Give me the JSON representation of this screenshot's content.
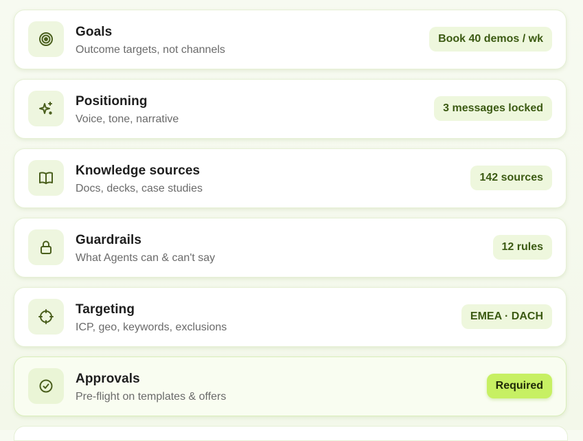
{
  "items": [
    {
      "title": "Goals",
      "subtitle": "Outcome targets, not channels",
      "badge": "Book 40 demos / wk",
      "icon": "target-icon"
    },
    {
      "title": "Positioning",
      "subtitle": "Voice, tone, narrative",
      "badge": "3 messages locked",
      "icon": "sparkles-icon"
    },
    {
      "title": "Knowledge sources",
      "subtitle": "Docs, decks, case studies",
      "badge": "142 sources",
      "icon": "book-open-icon"
    },
    {
      "title": "Guardrails",
      "subtitle": "What Agents can & can't say",
      "badge": "12 rules",
      "icon": "lock-icon"
    },
    {
      "title": "Targeting",
      "subtitle": "ICP, geo, keywords, exclusions",
      "badge": "EMEA · DACH",
      "icon": "crosshair-icon"
    },
    {
      "title": "Approvals",
      "subtitle": "Pre-flight on templates & offers",
      "badge": "Required",
      "icon": "check-circle-icon"
    }
  ],
  "colors": {
    "accent": "#c7f063",
    "badge_bg": "#eef7dd",
    "badge_text": "#3b5a12",
    "icon_bg": "#eef6df",
    "icon_stroke": "#4a5f1d"
  }
}
